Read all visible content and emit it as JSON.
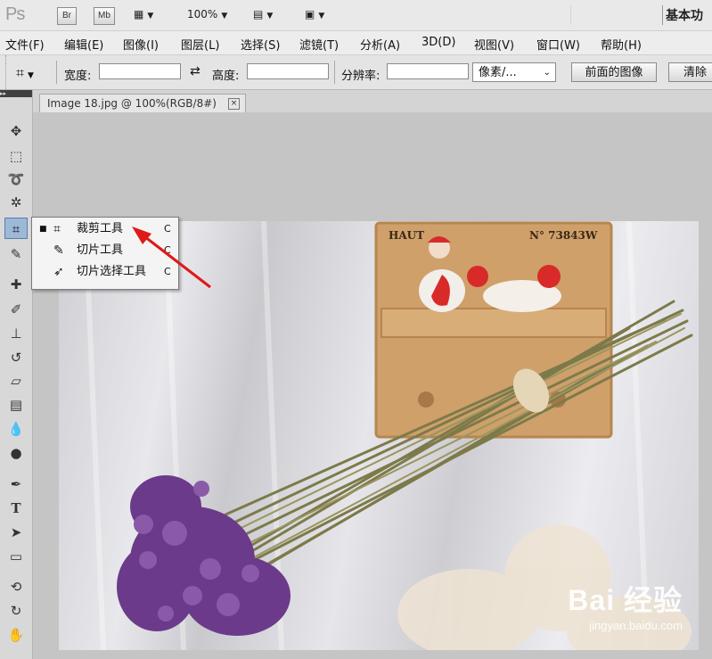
{
  "appbar": {
    "logo": "Ps",
    "bridge": "Br",
    "minibridge": "Mb",
    "zoom": "100%",
    "workspace": "基本功"
  },
  "menu": [
    "文件(F)",
    "编辑(E)",
    "图像(I)",
    "图层(L)",
    "选择(S)",
    "滤镜(T)",
    "分析(A)",
    "3D(D)",
    "视图(V)",
    "窗口(W)",
    "帮助(H)"
  ],
  "options": {
    "width_label": "宽度:",
    "width_value": "",
    "height_label": "高度:",
    "height_value": "",
    "resolution_label": "分辨率:",
    "resolution_value": "",
    "unit_value": "像素/...",
    "front_image_button": "前面的图像",
    "clear_button": "清除"
  },
  "document": {
    "tab_title": "Image 18.jpg @ 100%(RGB/8#)"
  },
  "image": {
    "sign_left": "HAUT",
    "sign_right": "N° 73843W"
  },
  "flyout": {
    "items": [
      {
        "label": "裁剪工具",
        "key": "C",
        "selected": true
      },
      {
        "label": "切片工具",
        "key": "C",
        "selected": false
      },
      {
        "label": "切片选择工具",
        "key": "C",
        "selected": false
      }
    ]
  },
  "watermark": {
    "brand": "Bai 经验",
    "url": "jingyan.baidu.com"
  },
  "colors": {
    "annotation_arrow": "#e01818",
    "active_tool": "#9eb9d8"
  }
}
